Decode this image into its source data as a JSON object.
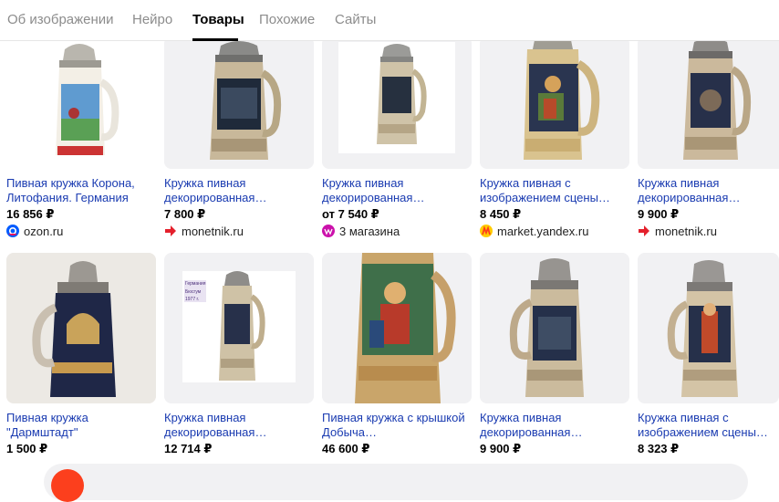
{
  "tabs": [
    {
      "label": "Об изображении"
    },
    {
      "label": "Нейро"
    },
    {
      "label": "Товары"
    },
    {
      "label": "Похожие"
    },
    {
      "label": "Сайты"
    }
  ],
  "products": [
    {
      "title": "Пивная кружка Корона, Литофания. Германия",
      "price": "16 856 ₽",
      "shop": "ozon.ru",
      "shop_icon": "ozon-icon"
    },
    {
      "title": "Кружка пивная декорированная…",
      "price": "7 800 ₽",
      "shop": "monetnik.ru",
      "shop_icon": "monetnik-arrow-icon"
    },
    {
      "title": "Кружка пивная декорированная…",
      "price": "от 7 540 ₽",
      "shop": "3 магазина",
      "shop_icon": "wildberries-icon"
    },
    {
      "title": "Кружка пивная с изображением сцены…",
      "price": "8 450 ₽",
      "shop": "market.yandex.ru",
      "shop_icon": "yandex-market-icon"
    },
    {
      "title": "Кружка пивная декорированная…",
      "price": "9 900 ₽",
      "shop": "monetnik.ru",
      "shop_icon": "monetnik-arrow-icon"
    },
    {
      "title": "Пивная кружка \"Дармштадт\"",
      "price": "1 500 ₽"
    },
    {
      "title": "Кружка пивная декорированная…",
      "price": "12 714 ₽"
    },
    {
      "title": "Пивная кружка с крышкой Добыча…",
      "price": "46 600 ₽"
    },
    {
      "title": "Кружка пивная декорированная…",
      "price": "9 900 ₽"
    },
    {
      "title": "Кружка пивная с изображением сцены…",
      "price": "8 323 ₽"
    }
  ],
  "thumb_labels": {
    "sign_line1": "Германия",
    "sign_line2": "Бюсгум",
    "sign_line3": "1977 г."
  },
  "colors": {
    "link": "#1a3bb1",
    "ozon": "#005bff",
    "monetnik": "#e4202c",
    "wildberries": "#cb11ab",
    "yandex_market": "#ffcc00"
  }
}
